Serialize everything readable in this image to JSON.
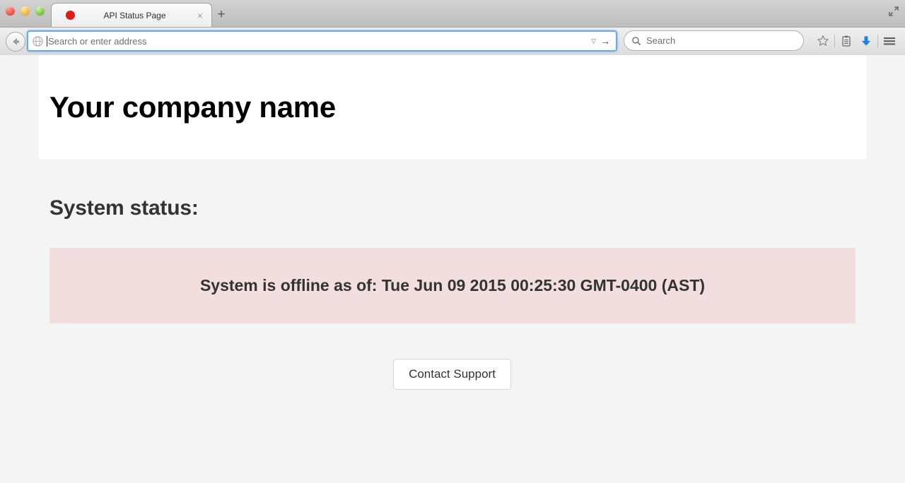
{
  "browser": {
    "window_controls": [
      {
        "name": "close",
        "color": "#f05b4b"
      },
      {
        "name": "minimize",
        "color": "#f7bd42"
      },
      {
        "name": "zoom",
        "color": "#86cc4b"
      }
    ],
    "tab": {
      "title": "API Status Page",
      "favicon": "red-dot-icon",
      "favicon_color": "#e01b19",
      "close_label": "×"
    },
    "new_tab_label": "+",
    "window_expand_icon": "fullscreen-icon",
    "back_button_icon": "back-arrow-icon",
    "url_bar": {
      "value": "",
      "placeholder": "Search or enter address",
      "site_icon": "globe-icon",
      "dropdown_label": "▽",
      "go_label": "→",
      "focused": true,
      "focus_color": "#6aa8e8"
    },
    "search_bar": {
      "value": "",
      "placeholder": "Search",
      "icon": "search-icon"
    },
    "toolbar_icons": [
      {
        "name": "bookmark-star-icon"
      },
      {
        "name": "reading-list-icon"
      },
      {
        "name": "downloads-icon",
        "color": "#1a82e2"
      },
      {
        "name": "menu-hamburger-icon"
      }
    ]
  },
  "page": {
    "header": {
      "company_name": "Your company name"
    },
    "status_heading": "System status:",
    "alert": {
      "message": "System is offline as of: Tue Jun 09 2015 00:25:30 GMT-0400 (AST)",
      "background_color": "#f2dede",
      "text_color": "#333333"
    },
    "contact_button": "Contact Support",
    "background_color": "#f4f4f4"
  }
}
